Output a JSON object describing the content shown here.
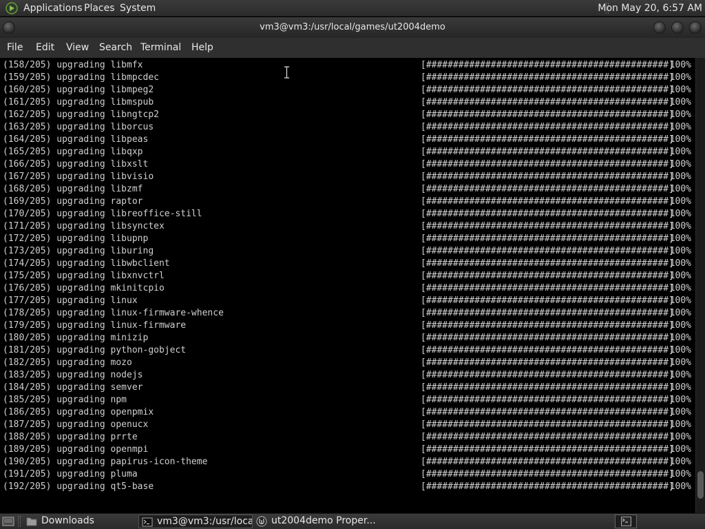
{
  "top_panel": {
    "applications": "Applications",
    "places": "Places",
    "system": "System",
    "clock": "Mon May 20,  6:57 AM",
    "menu_icon": "distro-logo-icon"
  },
  "window": {
    "title": "vm3@vm3:/usr/local/games/ut2004demo"
  },
  "menubar": {
    "file": "File",
    "edit": "Edit",
    "view": "View",
    "search": "Search",
    "terminal": "Terminal",
    "help": "Help"
  },
  "terminal": {
    "progress_bar": "[#############################################]",
    "lines": [
      {
        "text": "(158/205) upgrading libmfx",
        "percent": "100%"
      },
      {
        "text": "(159/205) upgrading libmpcdec",
        "percent": "100%"
      },
      {
        "text": "(160/205) upgrading libmpeg2",
        "percent": "100%"
      },
      {
        "text": "(161/205) upgrading libmspub",
        "percent": "100%"
      },
      {
        "text": "(162/205) upgrading libngtcp2",
        "percent": "100%"
      },
      {
        "text": "(163/205) upgrading liborcus",
        "percent": "100%"
      },
      {
        "text": "(164/205) upgrading libpeas",
        "percent": "100%"
      },
      {
        "text": "(165/205) upgrading libqxp",
        "percent": "100%"
      },
      {
        "text": "(166/205) upgrading libxslt",
        "percent": "100%"
      },
      {
        "text": "(167/205) upgrading libvisio",
        "percent": "100%"
      },
      {
        "text": "(168/205) upgrading libzmf",
        "percent": "100%"
      },
      {
        "text": "(169/205) upgrading raptor",
        "percent": "100%"
      },
      {
        "text": "(170/205) upgrading libreoffice-still",
        "percent": "100%"
      },
      {
        "text": "(171/205) upgrading libsynctex",
        "percent": "100%"
      },
      {
        "text": "(172/205) upgrading libupnp",
        "percent": "100%"
      },
      {
        "text": "(173/205) upgrading liburing",
        "percent": "100%"
      },
      {
        "text": "(174/205) upgrading libwbclient",
        "percent": "100%"
      },
      {
        "text": "(175/205) upgrading libxnvctrl",
        "percent": "100%"
      },
      {
        "text": "(176/205) upgrading mkinitcpio",
        "percent": "100%"
      },
      {
        "text": "(177/205) upgrading linux",
        "percent": "100%"
      },
      {
        "text": "(178/205) upgrading linux-firmware-whence",
        "percent": "100%"
      },
      {
        "text": "(179/205) upgrading linux-firmware",
        "percent": "100%"
      },
      {
        "text": "(180/205) upgrading minizip",
        "percent": "100%"
      },
      {
        "text": "(181/205) upgrading python-gobject",
        "percent": "100%"
      },
      {
        "text": "(182/205) upgrading mozo",
        "percent": "100%"
      },
      {
        "text": "(183/205) upgrading nodejs",
        "percent": "100%"
      },
      {
        "text": "(184/205) upgrading semver",
        "percent": "100%"
      },
      {
        "text": "(185/205) upgrading npm",
        "percent": "100%"
      },
      {
        "text": "(186/205) upgrading openpmix",
        "percent": "100%"
      },
      {
        "text": "(187/205) upgrading openucx",
        "percent": "100%"
      },
      {
        "text": "(188/205) upgrading prrte",
        "percent": "100%"
      },
      {
        "text": "(189/205) upgrading openmpi",
        "percent": "100%"
      },
      {
        "text": "(190/205) upgrading papirus-icon-theme",
        "percent": "100%"
      },
      {
        "text": "(191/205) upgrading pluma",
        "percent": "100%"
      },
      {
        "text": "(192/205) upgrading qt5-base",
        "percent": "100%"
      }
    ]
  },
  "scrollbar": {
    "position": 0.97
  },
  "taskbar": {
    "show_desktop_icon": "show-desktop-icon",
    "tasks": [
      {
        "label": "Downloads",
        "icon": "folder-icon"
      },
      {
        "label": "vm3@vm3:/usr/loca...",
        "icon": "terminal-icon",
        "active": true
      },
      {
        "label": "ut2004demo Proper...",
        "icon": "unreal-logo-icon"
      }
    ],
    "workspace_icon": "workspace-switcher-icon"
  },
  "colors": {
    "terminal_bg": "#000000",
    "terminal_fg": "#d0d0d0",
    "panel_bg": "#2f2f2f",
    "panel_fg": "#e6e6e6"
  }
}
